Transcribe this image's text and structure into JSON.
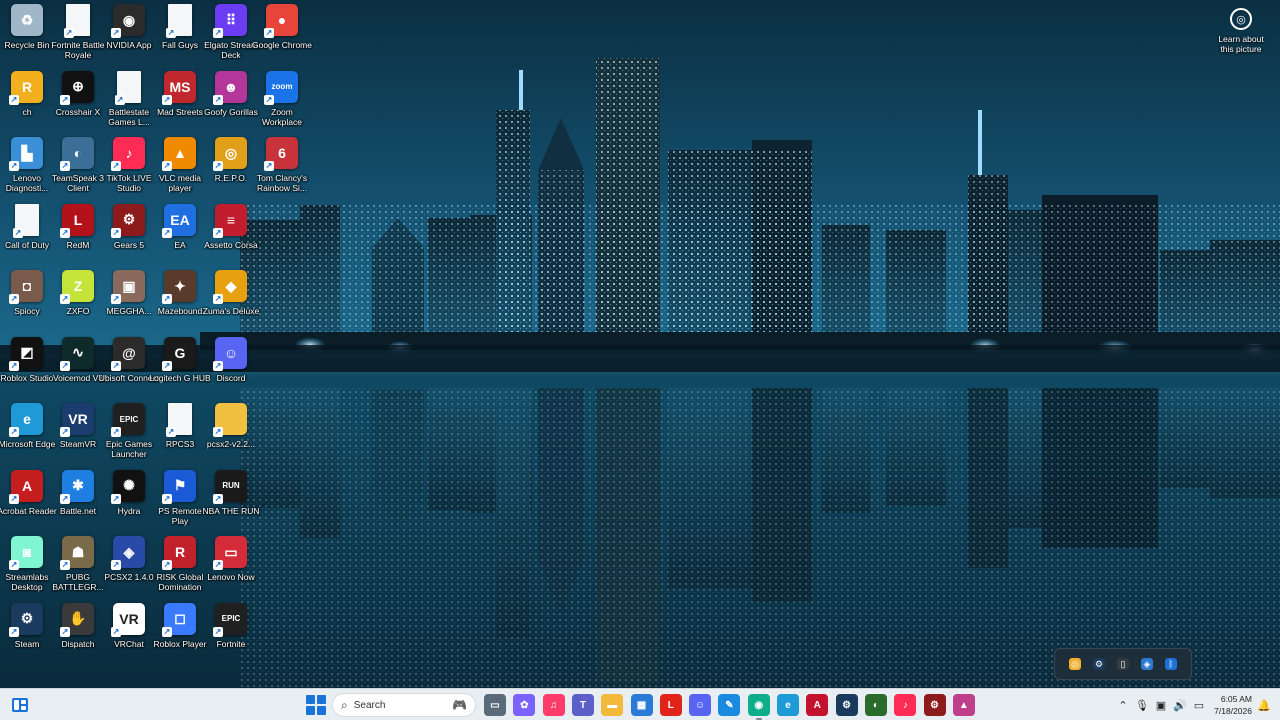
{
  "desktop": {
    "icons": [
      {
        "label": "Recycle Bin",
        "icon": "recycle-bin-icon",
        "bg": "#9fb6c8",
        "glyph": "♻"
      },
      {
        "label": "Fortnite Battle Royale",
        "icon": "file-icon",
        "bg": "#f4f6f8",
        "glyph": ""
      },
      {
        "label": "NVIDIA App",
        "icon": "nvidia-icon",
        "bg": "#2b2b2b",
        "glyph": "◉"
      },
      {
        "label": "Fall Guys",
        "icon": "file-icon",
        "bg": "#f4f6f8",
        "glyph": ""
      },
      {
        "label": "Elgato Stream Deck",
        "icon": "elgato-icon",
        "bg": "#6a3df2",
        "glyph": "⠿"
      },
      {
        "label": "Google Chrome",
        "icon": "chrome-icon",
        "bg": "#e7453a",
        "glyph": "●"
      },
      {
        "label": "ch",
        "icon": "rockstar-icon",
        "bg": "#f2b01e",
        "glyph": "R"
      },
      {
        "label": "Crosshair X",
        "icon": "crosshair-icon",
        "bg": "#111111",
        "glyph": "⊕"
      },
      {
        "label": "Battlestate Games L...",
        "icon": "file-icon",
        "bg": "#f4f6f8",
        "glyph": ""
      },
      {
        "label": "Mad Streets",
        "icon": "mad-streets-icon",
        "bg": "#c0282d",
        "glyph": "MS"
      },
      {
        "label": "Goofy Gorillas",
        "icon": "goofy-gorillas-icon",
        "bg": "#b4369a",
        "glyph": "☻"
      },
      {
        "label": "Zoom Workplace",
        "icon": "zoom-icon",
        "bg": "#1a73e8",
        "glyph": "zoom"
      },
      {
        "label": "Lenovo Diagnosti...",
        "icon": "lenovo-diagnostics-icon",
        "bg": "#3a8fd6",
        "glyph": "▙"
      },
      {
        "label": "TeamSpeak 3 Client",
        "icon": "teamspeak-icon",
        "bg": "#3b6f98",
        "glyph": "◐"
      },
      {
        "label": "TikTok LIVE Studio",
        "icon": "tiktok-live-icon",
        "bg": "#fe2c55",
        "glyph": "♪"
      },
      {
        "label": "VLC media player",
        "icon": "vlc-icon",
        "bg": "#f08a00",
        "glyph": "▲"
      },
      {
        "label": "R.E.P.O.",
        "icon": "repo-icon",
        "bg": "#e2a01a",
        "glyph": "◎"
      },
      {
        "label": "Tom Clancy's Rainbow Si...",
        "icon": "rainbow-six-icon",
        "bg": "#c8323a",
        "glyph": "6"
      },
      {
        "label": "Call of Duty",
        "icon": "file-icon",
        "bg": "#f4f6f8",
        "glyph": ""
      },
      {
        "label": "RedM",
        "icon": "redm-icon",
        "bg": "#b3121b",
        "glyph": "L"
      },
      {
        "label": "Gears 5",
        "icon": "gears-icon",
        "bg": "#8e1b1b",
        "glyph": "⚙"
      },
      {
        "label": "EA",
        "icon": "ea-icon",
        "bg": "#1f6fe0",
        "glyph": "EA"
      },
      {
        "label": "Assetto Corsa",
        "icon": "assetto-corsa-icon",
        "bg": "#c01e2e",
        "glyph": "≡"
      },
      {
        "label": "Spiocy",
        "icon": "spiocy-icon",
        "bg": "#7a5a4a",
        "glyph": "◘"
      },
      {
        "label": "ZXFO",
        "icon": "zxfo-icon",
        "bg": "#c5e43a",
        "glyph": "Z"
      },
      {
        "label": "MEGGHA...",
        "icon": "meggha-icon",
        "bg": "#8a6a5c",
        "glyph": "▣"
      },
      {
        "label": "Mazebound",
        "icon": "mazebound-icon",
        "bg": "#5a3a2a",
        "glyph": "✦"
      },
      {
        "label": "Zuma's Deluxe",
        "icon": "zuma-icon",
        "bg": "#e7a010",
        "glyph": "◆"
      },
      {
        "label": "Roblox Studio",
        "icon": "roblox-studio-icon",
        "bg": "#111111",
        "glyph": "◩"
      },
      {
        "label": "Voicemod V3",
        "icon": "voicemod-icon",
        "bg": "#0f2a2a",
        "glyph": "∿"
      },
      {
        "label": "Ubisoft Connect",
        "icon": "ubisoft-icon",
        "bg": "#2b2b2b",
        "glyph": "@"
      },
      {
        "label": "Logitech G HUB",
        "icon": "logitech-icon",
        "bg": "#1a1a1a",
        "glyph": "G"
      },
      {
        "label": "Discord",
        "icon": "discord-icon",
        "bg": "#5865f2",
        "glyph": "☺"
      },
      {
        "label": "Microsoft Edge",
        "icon": "edge-icon",
        "bg": "#1e9ad6",
        "glyph": "e"
      },
      {
        "label": "SteamVR",
        "icon": "steamvr-icon",
        "bg": "#1b3c6e",
        "glyph": "VR"
      },
      {
        "label": "Epic Games Launcher",
        "icon": "epic-games-icon",
        "bg": "#202020",
        "glyph": "EPIC"
      },
      {
        "label": "RPCS3",
        "icon": "file-icon",
        "bg": "#f4f6f8",
        "glyph": ""
      },
      {
        "label": "pcsx2-v2.2...",
        "icon": "folder-icon",
        "bg": "#f2c040",
        "glyph": ""
      },
      {
        "label": "Acrobat Reader",
        "icon": "acrobat-icon",
        "bg": "#c41e1e",
        "glyph": "A"
      },
      {
        "label": "Battle.net",
        "icon": "battlenet-icon",
        "bg": "#1e7fe0",
        "glyph": "✱"
      },
      {
        "label": "Hydra",
        "icon": "hydra-icon",
        "bg": "#111111",
        "glyph": "✺"
      },
      {
        "label": "PS Remote Play",
        "icon": "ps-remote-play-icon",
        "bg": "#1b5ad6",
        "glyph": "⚑"
      },
      {
        "label": "NBA THE RUN",
        "icon": "nba-the-run-icon",
        "bg": "#1a1a1a",
        "glyph": "RUN"
      },
      {
        "label": "Streamlabs Desktop",
        "icon": "streamlabs-icon",
        "bg": "#80f5d2",
        "glyph": "◙"
      },
      {
        "label": "PUBG BATTLEGR...",
        "icon": "pubg-icon",
        "bg": "#7a6a4a",
        "glyph": "☗"
      },
      {
        "label": "PCSX2 1.4.0",
        "icon": "pcsx2-icon",
        "bg": "#2a4aa8",
        "glyph": "◈"
      },
      {
        "label": "RISK Global Domination",
        "icon": "risk-icon",
        "bg": "#c0212b",
        "glyph": "R"
      },
      {
        "label": "Lenovo Now",
        "icon": "lenovo-now-icon",
        "bg": "#d42b3b",
        "glyph": "▭"
      },
      {
        "label": "Steam",
        "icon": "steam-icon",
        "bg": "#1a3a5e",
        "glyph": "⚙"
      },
      {
        "label": "Dispatch",
        "icon": "dispatch-icon",
        "bg": "#3a3a3a",
        "glyph": "✋"
      },
      {
        "label": "VRChat",
        "icon": "vrchat-icon",
        "bg": "#ffffff",
        "glyph": "VR"
      },
      {
        "label": "Roblox Player",
        "icon": "roblox-player-icon",
        "bg": "#3a7aff",
        "glyph": "◻"
      },
      {
        "label": "Fortnite",
        "icon": "epic-games-icon",
        "bg": "#202020",
        "glyph": "EPIC"
      }
    ],
    "learn_about": "Learn about this picture"
  },
  "tray_flyout": [
    {
      "icon": "tray-app-icon",
      "bg": "#f0b030",
      "glyph": "◎"
    },
    {
      "icon": "steam-tray-icon",
      "bg": "#1a3a5e",
      "glyph": "⚙"
    },
    {
      "icon": "usb-icon",
      "bg": "#333a40",
      "glyph": "▯"
    },
    {
      "icon": "security-icon",
      "bg": "#2a7ad0",
      "glyph": "◈"
    },
    {
      "icon": "bluetooth-icon",
      "bg": "#1e6fd8",
      "glyph": "ᛒ"
    }
  ],
  "taskbar": {
    "search_placeholder": "Search",
    "apps": [
      {
        "icon": "task-view-icon",
        "bg": "#5a6a78",
        "glyph": "▭"
      },
      {
        "icon": "copilot-icon",
        "bg": "#7b61ff",
        "glyph": "✿"
      },
      {
        "icon": "itunes-icon",
        "bg": "#ff3b6b",
        "glyph": "♫"
      },
      {
        "icon": "teams-icon",
        "bg": "#5b5fc7",
        "glyph": "T"
      },
      {
        "icon": "file-explorer-icon",
        "bg": "#f2b93b",
        "glyph": "▬"
      },
      {
        "icon": "microsoft-store-icon",
        "bg": "#2a7ad8",
        "glyph": "▦"
      },
      {
        "icon": "lenovo-icon",
        "bg": "#e2231a",
        "glyph": "L"
      },
      {
        "icon": "discord-icon",
        "bg": "#5865f2",
        "glyph": "☺"
      },
      {
        "icon": "draw-icon",
        "bg": "#1a8ae0",
        "glyph": "✎"
      },
      {
        "icon": "ai-app-icon",
        "bg": "#0fae8a",
        "glyph": "◉"
      },
      {
        "icon": "edge-icon",
        "bg": "#1e9ad6",
        "glyph": "e"
      },
      {
        "icon": "adobe-icon",
        "bg": "#c4122d",
        "glyph": "A"
      },
      {
        "icon": "steam-icon",
        "bg": "#1a3a5e",
        "glyph": "⚙"
      },
      {
        "icon": "xbox-game-bar-icon",
        "bg": "#2a6a2a",
        "glyph": "◐"
      },
      {
        "icon": "tiktok-icon",
        "bg": "#fe2c55",
        "glyph": "♪"
      },
      {
        "icon": "gears-icon",
        "bg": "#8e1b1b",
        "glyph": "⚙"
      },
      {
        "icon": "photos-icon",
        "bg": "#c03f8c",
        "glyph": "▲"
      }
    ],
    "time": "6:05 AM",
    "date": "7/18/2026"
  },
  "colors": {
    "taskbar_bg": "#e9eef2",
    "accent": "#1a73d9"
  }
}
